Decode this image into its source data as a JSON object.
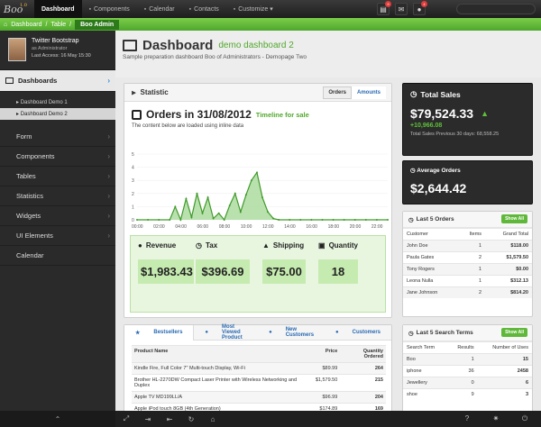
{
  "brand": {
    "logo": "Boo",
    "version": "1.0"
  },
  "nav": [
    {
      "label": "Dashboard",
      "icon": "",
      "active": true
    },
    {
      "label": "Components",
      "icon": "grid-icon"
    },
    {
      "label": "Calendar",
      "icon": "calendar-icon"
    },
    {
      "label": "Contacts",
      "icon": "contacts-icon"
    },
    {
      "label": "Customize ▾",
      "icon": "gear-icon"
    }
  ],
  "top_icons": [
    {
      "icon": "notes-icon",
      "glyph": "▤",
      "badge": "9"
    },
    {
      "icon": "mail-icon",
      "glyph": "✉",
      "badge": ""
    },
    {
      "icon": "globe-icon",
      "glyph": "●",
      "badge": "4"
    }
  ],
  "breadcrumb": [
    "Dashboard",
    "Table",
    "Boo Admin"
  ],
  "profile": {
    "name": "Twitter Bootstrap",
    "role": "as Administrator",
    "last": "Last Access: 16 May 15:30"
  },
  "sidebar": {
    "dashboards": "Dashboards",
    "subs": [
      "Dashboard Demo 1",
      "Dashboard Demo 2"
    ],
    "items": [
      "Form",
      "Components",
      "Tables",
      "Statistics",
      "Widgets",
      "UI Elements",
      "Calendar"
    ]
  },
  "page": {
    "title": "Dashboard",
    "subtitle": "demo dashboard 2",
    "desc": "Sample preparation dashboard Boo of Administrators - Demopage Two"
  },
  "statistic": {
    "title": "Statistic",
    "tab_orders": "Orders",
    "tab_amounts": "Amounts",
    "orders_title": "Orders in 31/08/2012",
    "timeline": "Timeline for sale",
    "loaded": "The content below are loaded using inline data"
  },
  "chart_data": {
    "type": "area",
    "x": [
      "00:00",
      "02:00",
      "04:00",
      "06:00",
      "08:00",
      "10:00",
      "12:00",
      "14:00",
      "16:00",
      "18:00",
      "20:00",
      "22:00"
    ],
    "y_ticks": [
      "0",
      "1",
      "2",
      "3",
      "4",
      "5"
    ],
    "ylim": [
      0,
      5
    ],
    "points": [
      [
        0,
        0
      ],
      [
        1,
        0
      ],
      [
        2,
        0
      ],
      [
        3,
        0
      ],
      [
        3.5,
        1
      ],
      [
        4,
        0
      ],
      [
        4.5,
        1.6
      ],
      [
        5,
        0.2
      ],
      [
        5.5,
        2
      ],
      [
        6,
        0.5
      ],
      [
        6.5,
        1.7
      ],
      [
        7,
        0.1
      ],
      [
        7.5,
        0.5
      ],
      [
        8,
        0
      ],
      [
        8.5,
        1.1
      ],
      [
        9,
        2
      ],
      [
        9.5,
        0.6
      ],
      [
        10,
        1.9
      ],
      [
        10.5,
        3
      ],
      [
        11,
        3.6
      ],
      [
        11.5,
        1.7
      ],
      [
        12,
        0.6
      ],
      [
        12.5,
        0.1
      ],
      [
        13,
        0
      ],
      [
        14,
        0
      ],
      [
        15,
        0
      ],
      [
        16,
        0
      ],
      [
        17,
        0
      ],
      [
        18,
        0
      ],
      [
        19,
        0
      ],
      [
        20,
        0
      ],
      [
        21,
        0
      ],
      [
        22,
        0
      ],
      [
        23,
        0
      ]
    ]
  },
  "kpis": [
    {
      "label": "Revenue",
      "icon": "money-icon",
      "glyph": "●",
      "value": "$1,983.43"
    },
    {
      "label": "Tax",
      "icon": "clock-icon",
      "glyph": "◷",
      "value": "$396.69"
    },
    {
      "label": "Shipping",
      "icon": "flask-icon",
      "glyph": "▲",
      "value": "$75.00"
    },
    {
      "label": "Quantity",
      "icon": "list-icon",
      "glyph": "▣",
      "value": "18"
    }
  ],
  "total_sales": {
    "title": "Total Sales",
    "value": "$79,524.33",
    "change": "+10,966.08",
    "prev": "Total Sales Previous 30 days: 68,558.25"
  },
  "avg_orders": {
    "title": "Average Orders",
    "value": "$2,644.42"
  },
  "last_orders": {
    "title": "Last 5 Orders",
    "show_all": "Show All",
    "headers": [
      "Customer",
      "Items",
      "Grand Total"
    ],
    "rows": [
      [
        "John Doe",
        "1",
        "$118.00"
      ],
      [
        "Paula Gates",
        "2",
        "$1,579.50"
      ],
      [
        "Tony Rogers",
        "1",
        "$0.00"
      ],
      [
        "Leona Nulla",
        "1",
        "$312.13"
      ],
      [
        "Jane Johnson",
        "2",
        "$814.20"
      ]
    ]
  },
  "last_search": {
    "title": "Last 5 Search Terms",
    "show_all": "Show All",
    "headers": [
      "Search Term",
      "Results",
      "Number of Uses"
    ],
    "rows": [
      [
        "Boo",
        "1",
        "15"
      ],
      [
        "iphone",
        "36",
        "2458"
      ],
      [
        "Jewellery",
        "0",
        "6"
      ],
      [
        "shoe",
        "9",
        "3"
      ]
    ]
  },
  "bestsellers": {
    "tabs": [
      "Bestsellers",
      "Most Viewed Product",
      "New Customers",
      "Customers"
    ],
    "headers": [
      "Product Name",
      "Price",
      "Quantity Ordered"
    ],
    "rows": [
      [
        "Kindle Fire, Full Color 7\" Multi-touch Display, Wi-Fi",
        "$89.99",
        "264"
      ],
      [
        "Brother HL-2270DW Compact Laser Printer with Wireless Networking and Duplex",
        "$1,579.50",
        "215"
      ],
      [
        "Apple TV MD199LL/A",
        "$96.99",
        "204"
      ],
      [
        "Apple iPod touch 8GB (4th Generation)",
        "$174.89",
        "169"
      ]
    ]
  }
}
